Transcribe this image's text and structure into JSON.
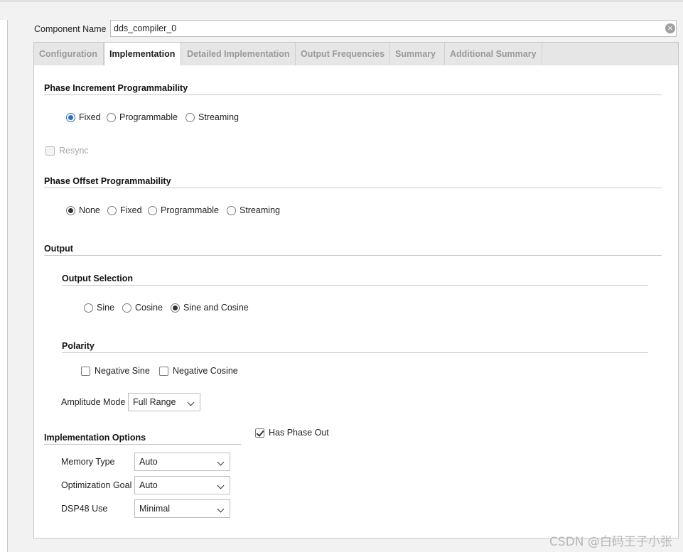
{
  "component": {
    "label": "Component Name",
    "value": "dds_compiler_0"
  },
  "tabs": [
    {
      "label": "Configuration",
      "active": false
    },
    {
      "label": "Implementation",
      "active": true
    },
    {
      "label": "Detailed Implementation",
      "active": false
    },
    {
      "label": "Output Frequencies",
      "active": false
    },
    {
      "label": "Summary",
      "active": false
    },
    {
      "label": "Additional Summary",
      "active": false
    }
  ],
  "phase_increment": {
    "title": "Phase Increment Programmability",
    "options": [
      "Fixed",
      "Programmable",
      "Streaming"
    ],
    "selected": "Fixed",
    "resync_label": "Resync",
    "resync_checked": false,
    "resync_enabled": false
  },
  "phase_offset": {
    "title": "Phase Offset Programmability",
    "options": [
      "None",
      "Fixed",
      "Programmable",
      "Streaming"
    ],
    "selected": "None"
  },
  "output": {
    "title": "Output",
    "selection": {
      "title": "Output Selection",
      "options": [
        "Sine",
        "Cosine",
        "Sine and Cosine"
      ],
      "selected": "Sine and Cosine"
    },
    "polarity": {
      "title": "Polarity",
      "negative_sine_label": "Negative Sine",
      "negative_sine_checked": false,
      "negative_cosine_label": "Negative Cosine",
      "negative_cosine_checked": false
    },
    "amplitude": {
      "label": "Amplitude Mode",
      "value": "Full Range"
    }
  },
  "implementation_options": {
    "title": "Implementation Options",
    "memory_type": {
      "label": "Memory Type",
      "value": "Auto"
    },
    "optimization_goal": {
      "label": "Optimization Goal",
      "value": "Auto"
    },
    "dsp48_use": {
      "label": "DSP48 Use",
      "value": "Minimal"
    }
  },
  "has_phase_out": {
    "label": "Has Phase Out",
    "checked": true
  },
  "watermark": "CSDN @白码王子小张",
  "icons": {
    "clear": "clear-icon",
    "dropdown": "chevron-down-icon"
  }
}
